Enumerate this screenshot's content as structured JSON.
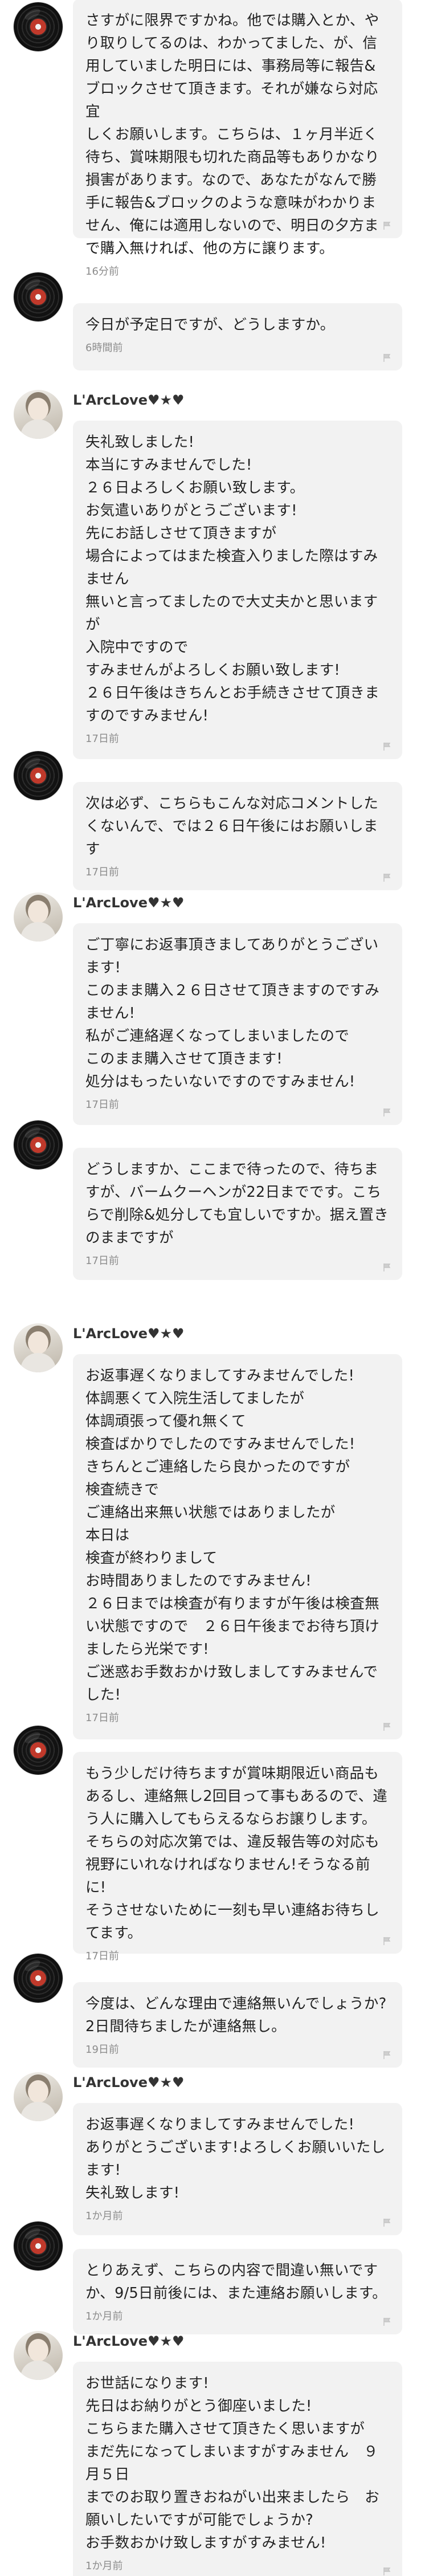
{
  "messages": [
    {
      "avatar": "record",
      "username": "",
      "text": "さすがに限界ですかね。他では購入とか、や\nり取りしてるのは、わかってました、が、信\n用していました明日には、事務局等に報告&\nブロックさせて頂きます。それが嫌なら対応宜\nしくお願いします。こちらは、１ヶ月半近く\n待ち、賞味期限も切れた商品等もありかなり\n損害があります。なので、あなたがなんで勝\n手に報告&ブロックのような意味がわかりま\nせん、俺には適用しないので、明日の夕方ま\nで購入無ければ、他の方に譲ります。",
      "time": "16分前"
    },
    {
      "avatar": "record",
      "username": "",
      "text": "今日が予定日ですが、どうしますか。",
      "time": "6時間前"
    },
    {
      "avatar": "photo",
      "username": "L'ArcLove♥★♥",
      "text": "失礼致しました!\n本当にすみませんでした!\n２６日よろしくお願い致します。\nお気遣いありがとうございます!\n先にお話しさせて頂きますが\n場合によってはまた検査入りました際はすみ\nません\n無いと言ってましたので大丈夫かと思います\nが\n入院中ですので\nすみませんがよろしくお願い致します!\n２６日午後はきちんとお手続きさせて頂きま\nすのですみません!",
      "time": "17日前"
    },
    {
      "avatar": "record",
      "username": "",
      "text": "次は必ず、こちらもこんな対応コメントした\nくないんで、では２６日午後にはお願いしま\nす",
      "time": "17日前"
    },
    {
      "avatar": "photo",
      "username": "L'ArcLove♥★♥",
      "text": "ご丁寧にお返事頂きましてありがとうござい\nます!\nこのまま購入２６日させて頂きますのですみ\nません!\n私がご連絡遅くなってしまいましたので\nこのまま購入させて頂きます!\n処分はもったいないですのですみません!",
      "time": "17日前"
    },
    {
      "avatar": "record",
      "username": "",
      "text": "どうしますか、ここまで待ったので、待ちま\nすが、バームクーヘンが22日までです。こち\nらで削除&処分しても宜しいですか。据え置き\nのままですが",
      "time": "17日前"
    },
    {
      "avatar": "photo",
      "username": "L'ArcLove♥★♥",
      "text": "お返事遅くなりましてすみませんでした!\n体調悪くて入院生活してましたが\n体調頑張って優れ無くて\n検査ばかりでしたのですみませんでした!\nきちんとご連絡したら良かったのですが\n検査続きで\nご連絡出来無い状態ではありましたが\n本日は\n検査が終わりまして\nお時間ありましたのですみません!\n２６日までは検査が有りますが午後は検査無\nい状態ですので　２６日午後までお待ち頂け\nましたら光栄です!\nご迷惑お手数おかけ致しましてすみませんで\nした!",
      "time": "17日前"
    },
    {
      "avatar": "record",
      "username": "",
      "text": "もう少しだけ待ちますが賞味期限近い商品も\nあるし、連絡無し2回目って事もあるので、違\nう人に購入してもらえるならお譲りします。\nそちらの対応次第では、違反報告等の対応も\n視野にいれなければなりません!そうなる前に!\nそうさせないために一刻も早い連絡お待ちし\nてます。",
      "time": "17日前"
    },
    {
      "avatar": "record",
      "username": "",
      "text": "今度は、どんな理由で連絡無いんでしょうか?\n2日間待ちましたが連絡無し。",
      "time": "19日前"
    },
    {
      "avatar": "photo",
      "username": "L'ArcLove♥★♥",
      "text": "お返事遅くなりましてすみませんでした!\nありがとうございます!よろしくお願いいたし\nます!\n失礼致します!",
      "time": "1か月前"
    },
    {
      "avatar": "record",
      "username": "",
      "text": "とりあえず、こちらの内容で間違い無いです\nか、9/5日前後には、また連絡お願いします。",
      "time": "1か月前"
    },
    {
      "avatar": "photo",
      "username": "L'ArcLove♥★♥",
      "text": "お世話になります!\n先日はお納りがとう御座いました!\nこちらまた購入させて頂きたく思いますが\nまだ先になってしまいますがすみません　９\n月５日\nまでのお取り置きおねがい出来ましたら　お\n願いしたいですが可能でしょうか?\nお手数おかけ致しますがすみません!",
      "time": "1か月前"
    }
  ],
  "icons": {
    "avatar_record": "vinyl-record-avatar-icon",
    "avatar_photo": "user-photo-avatar-icon",
    "flag": "report-flag-icon"
  }
}
